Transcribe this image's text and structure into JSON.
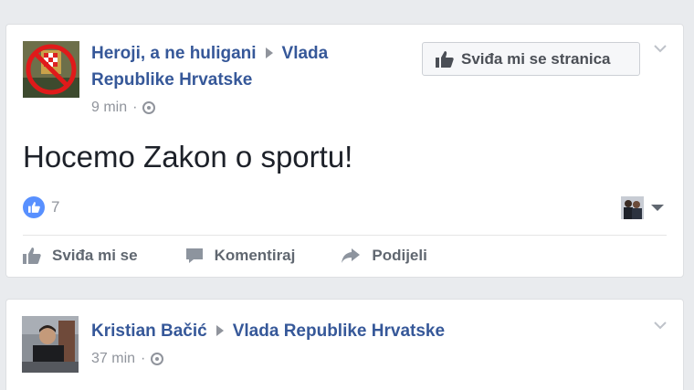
{
  "posts": [
    {
      "author": "Heroji, a ne huligani",
      "target": "Vlada",
      "target2": "Republike Hrvatske",
      "time": "9 min",
      "separator": "·",
      "like_page_label": "Sviđa mi se stranica",
      "text": "Hocemo Zakon o sportu!",
      "reaction_count": "7",
      "actions": {
        "like": "Sviđa mi se",
        "comment": "Komentiraj",
        "share": "Podijeli"
      }
    },
    {
      "author": "Kristian Bačić",
      "target": "Vlada Republike Hrvatske",
      "time": "37 min",
      "separator": "·"
    }
  ],
  "colors": {
    "link": "#365899",
    "muted": "#90949c",
    "like_blue": "#5890ff",
    "background": "#e9ebee"
  },
  "icons": [
    "thumbs-up-icon",
    "globe-icon",
    "chevron-down-icon",
    "comment-icon",
    "share-arrow-icon",
    "like-reaction-icon",
    "caret-down-icon"
  ]
}
